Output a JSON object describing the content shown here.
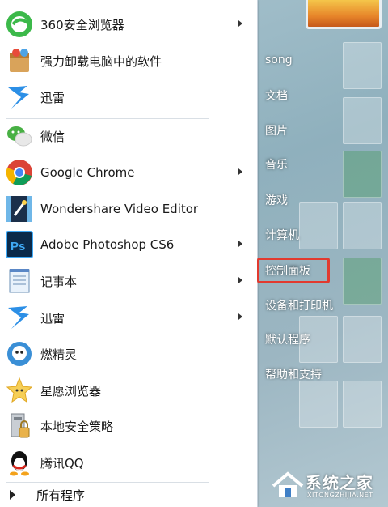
{
  "left_items": [
    {
      "label": "360安全浏览器",
      "icon": "360-browser-icon",
      "arrow": true
    },
    {
      "label": "强力卸载电脑中的软件",
      "icon": "uninstall-icon",
      "arrow": false
    },
    {
      "label": "迅雷",
      "icon": "xunlei-icon",
      "arrow": false
    },
    {
      "label": "微信",
      "icon": "wechat-icon",
      "arrow": false
    },
    {
      "label": "Google Chrome",
      "icon": "chrome-icon",
      "arrow": true
    },
    {
      "label": "Wondershare Video Editor",
      "icon": "video-editor-icon",
      "arrow": false
    },
    {
      "label": "Adobe Photoshop CS6",
      "icon": "photoshop-icon",
      "arrow": true
    },
    {
      "label": "记事本",
      "icon": "notepad-icon",
      "arrow": true
    },
    {
      "label": "迅雷",
      "icon": "xunlei-icon",
      "arrow": true
    },
    {
      "label": "燃精灵",
      "icon": "fire-elf-icon",
      "arrow": false
    },
    {
      "label": "星愿浏览器",
      "icon": "star-browser-icon",
      "arrow": false
    },
    {
      "label": "本地安全策略",
      "icon": "security-policy-icon",
      "arrow": false
    },
    {
      "label": "腾讯QQ",
      "icon": "qq-icon",
      "arrow": false
    }
  ],
  "all_programs": "所有程序",
  "right_items": [
    {
      "label": "song"
    },
    {
      "label": "文档"
    },
    {
      "label": "图片"
    },
    {
      "label": "音乐"
    },
    {
      "label": "游戏"
    },
    {
      "label": "计算机"
    },
    {
      "label": "控制面板",
      "highlighted": true
    },
    {
      "label": "设备和打印机"
    },
    {
      "label": "默认程序"
    },
    {
      "label": "帮助和支持"
    }
  ],
  "watermark": {
    "title": "系统之家",
    "url": "XITONGZHIJIA.NET"
  },
  "colors": {
    "highlight_border": "#e23a2f",
    "menu_bg": "#ffffff",
    "right_text": "#ffffff"
  }
}
